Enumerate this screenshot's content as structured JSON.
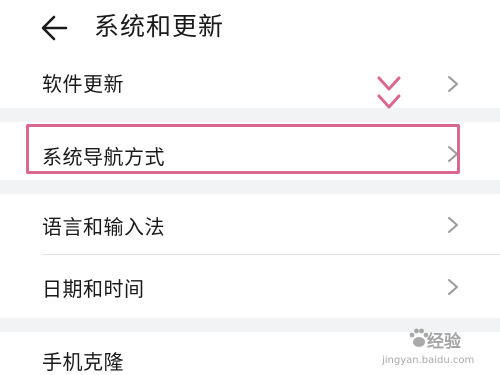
{
  "header": {
    "title": "系统和更新",
    "back_icon": "back-arrow-icon"
  },
  "items": [
    {
      "label": "软件更新"
    },
    {
      "label": "系统导航方式"
    },
    {
      "label": "语言和输入法"
    },
    {
      "label": "日期和时间"
    },
    {
      "label": "手机克隆"
    }
  ],
  "annotation": {
    "highlight_color": "#d9678f",
    "arrow_color": "#d9678f"
  },
  "watermark": {
    "text": "经验",
    "url": "jingyan.baidu.com"
  }
}
